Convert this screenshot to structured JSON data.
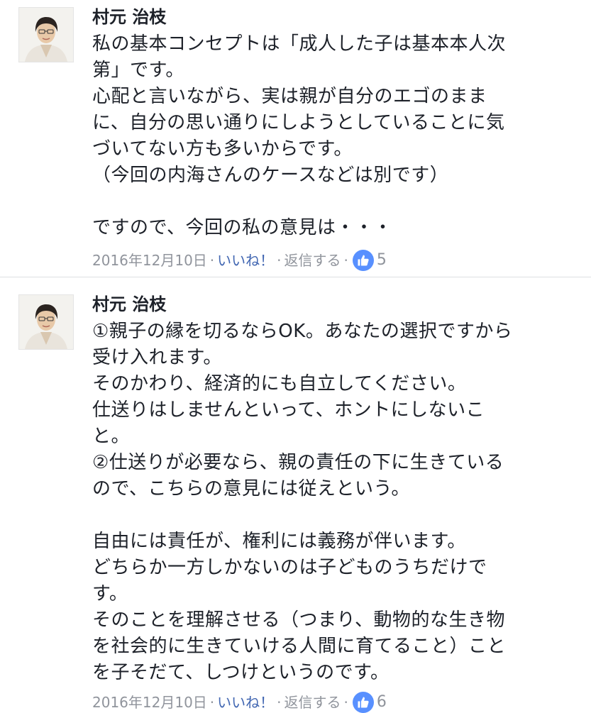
{
  "comments": [
    {
      "author": "村元 治枝",
      "lines": [
        "私の基本コンセプトは「成人した子は基本本人次",
        "第」です。",
        "心配と言いながら、実は親が自分のエゴのまま",
        "に、自分の思い通りにしようとしていることに気",
        "づいてない方も多いからです。",
        "（今回の内海さんのケースなどは別です）",
        "",
        "ですので、今回の私の意見は・・・"
      ],
      "date": "2016年12月10日",
      "like_label": "いいね！",
      "reply_label": "返信する",
      "separator": "·",
      "like_count": "5",
      "like_icon": "thumbs-up-icon"
    },
    {
      "author": "村元 治枝",
      "lines": [
        "①親子の縁を切るならOK。あなたの選択ですから",
        "受け入れます。",
        "そのかわり、経済的にも自立してください。",
        "仕送りはしませんといって、ホントにしないこ",
        "と。",
        "②仕送りが必要なら、親の責任の下に生きている",
        "ので、こちらの意見には従えという。",
        "",
        "自由には責任が、権利には義務が伴います。",
        "どちらか一方しかないのは子どものうちだけで",
        "す。",
        "そのことを理解させる（つまり、動物的な生き物",
        "を社会的に生きていける人間に育てること）こと",
        "を子そだて、しつけというのです。"
      ],
      "date": "2016年12月10日",
      "like_label": "いいね！",
      "reply_label": "返信する",
      "separator": "·",
      "like_count": "6",
      "like_icon": "thumbs-up-icon"
    }
  ],
  "colors": {
    "link": "#4267b2",
    "meta": "#90949c",
    "like_badge": "#5890ff",
    "text": "#1d2129"
  }
}
